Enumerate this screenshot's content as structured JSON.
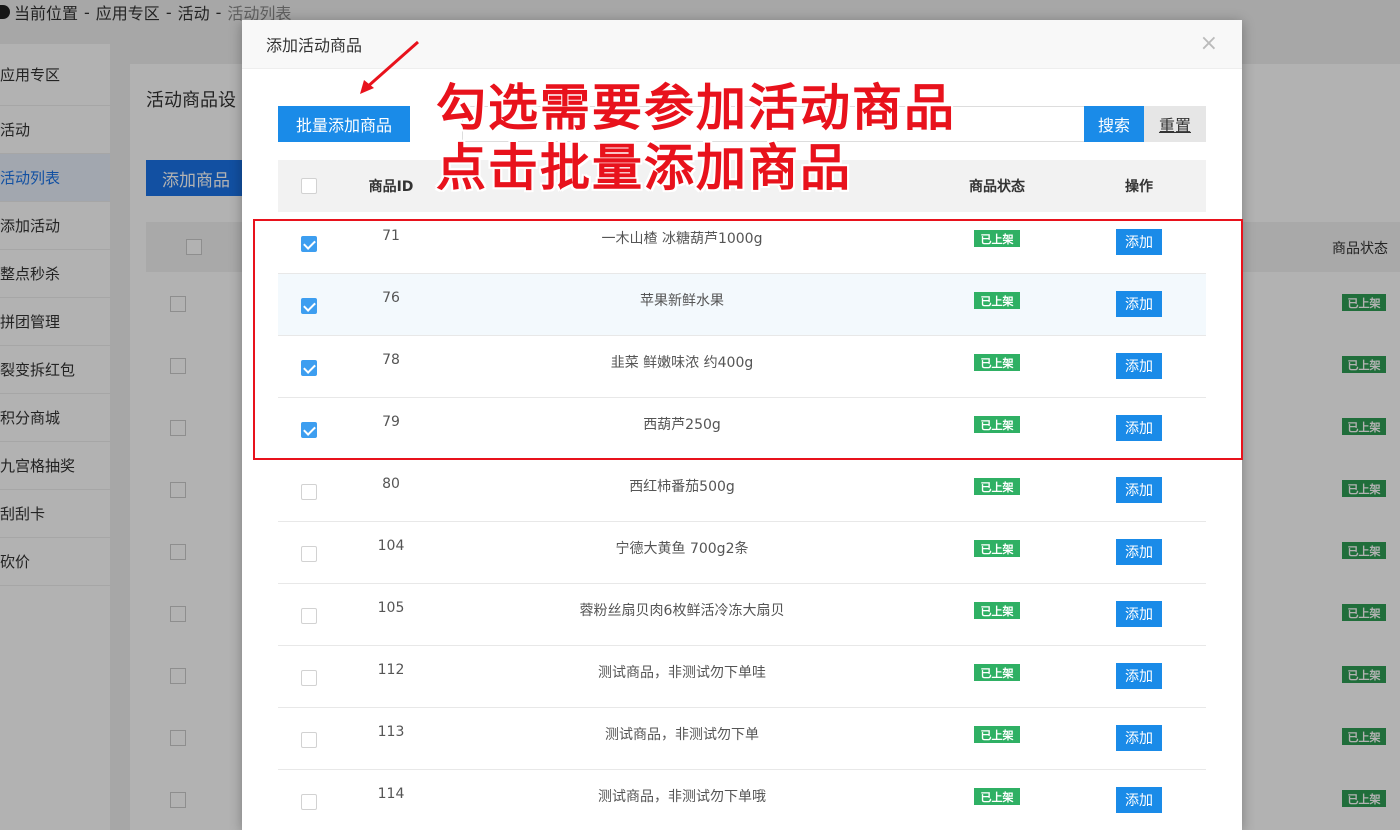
{
  "breadcrumb": {
    "prefix": "当前位置",
    "items": [
      "应用专区",
      "活动",
      "活动列表"
    ]
  },
  "sidebar": {
    "items": [
      {
        "label": "应用专区",
        "active": false
      },
      {
        "label": "活动",
        "active": false
      },
      {
        "label": "活动列表",
        "active": true
      },
      {
        "label": "添加活动",
        "active": false
      },
      {
        "label": "整点秒杀",
        "active": false
      },
      {
        "label": "拼团管理",
        "active": false
      },
      {
        "label": "裂变拆红包",
        "active": false
      },
      {
        "label": "积分商城",
        "active": false
      },
      {
        "label": "九宫格抽奖",
        "active": false
      },
      {
        "label": "刮刮卡",
        "active": false
      },
      {
        "label": "砍价",
        "active": false
      }
    ]
  },
  "background_page": {
    "title": "活动商品设",
    "add_button": "添加商品",
    "status_column": "商品状态",
    "badge": "已上架"
  },
  "modal": {
    "title": "添加活动商品",
    "close_symbol": "×",
    "batch_add_button": "批量添加商品",
    "search_button": "搜索",
    "reset_button": "重置",
    "columns": {
      "id": "商品ID",
      "name": "",
      "status": "商品状态",
      "operation": "操作"
    },
    "add_label": "添加",
    "rows": [
      {
        "id": "71",
        "name": "一木山楂 冰糖葫芦1000g",
        "status": "已上架",
        "checked": true
      },
      {
        "id": "76",
        "name": "苹果新鲜水果",
        "status": "已上架",
        "checked": true
      },
      {
        "id": "78",
        "name": "韭菜 鲜嫩味浓 约400g",
        "status": "已上架",
        "checked": true
      },
      {
        "id": "79",
        "name": "西葫芦250g",
        "status": "已上架",
        "checked": true
      },
      {
        "id": "80",
        "name": "西红柿番茄500g",
        "status": "已上架",
        "checked": false
      },
      {
        "id": "104",
        "name": "宁德大黄鱼 700g2条",
        "status": "已上架",
        "checked": false
      },
      {
        "id": "105",
        "name": "蓉粉丝扇贝肉6枚鲜活冷冻大扇贝",
        "status": "已上架",
        "checked": false
      },
      {
        "id": "112",
        "name": "测试商品，非测试勿下单哇",
        "status": "已上架",
        "checked": false
      },
      {
        "id": "113",
        "name": "测试商品，非测试勿下单",
        "status": "已上架",
        "checked": false
      },
      {
        "id": "114",
        "name": "测试商品，非测试勿下单哦",
        "status": "已上架",
        "checked": false
      }
    ]
  },
  "annotations": {
    "line1": "勾选需要参加活动商品",
    "line2": "点击批量添加商品",
    "color": "#e8121c"
  }
}
